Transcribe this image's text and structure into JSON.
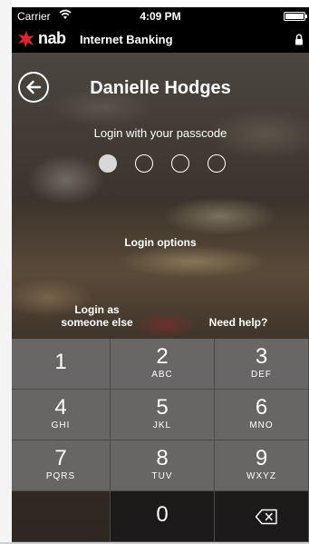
{
  "status_bar": {
    "carrier": "Carrier",
    "time": "4:09 PM"
  },
  "nav_bar": {
    "brand": "nab",
    "title": "Internet Banking"
  },
  "login": {
    "user_name": "Danielle Hodges",
    "prompt": "Login with your passcode",
    "passcode_length": 4,
    "digits_entered": 1,
    "options_label": "Login options",
    "someone_else_line1": "Login as",
    "someone_else_line2": "someone else",
    "need_help": "Need help?"
  },
  "keypad": [
    {
      "digit": "1",
      "letters": ""
    },
    {
      "digit": "2",
      "letters": "ABC"
    },
    {
      "digit": "3",
      "letters": "DEF"
    },
    {
      "digit": "4",
      "letters": "GHI"
    },
    {
      "digit": "5",
      "letters": "JKL"
    },
    {
      "digit": "6",
      "letters": "MNO"
    },
    {
      "digit": "7",
      "letters": "PQRS"
    },
    {
      "digit": "8",
      "letters": "TUV"
    },
    {
      "digit": "9",
      "letters": "WXYZ"
    },
    {
      "digit": "0",
      "letters": ""
    }
  ],
  "colors": {
    "brand_red": "#d8262e",
    "nav_background": "#000000"
  },
  "icons": {
    "back": "back-arrow-icon",
    "lock": "lock-icon",
    "delete": "backspace-icon",
    "wifi": "wifi-icon",
    "brand": "nab-star-icon"
  }
}
